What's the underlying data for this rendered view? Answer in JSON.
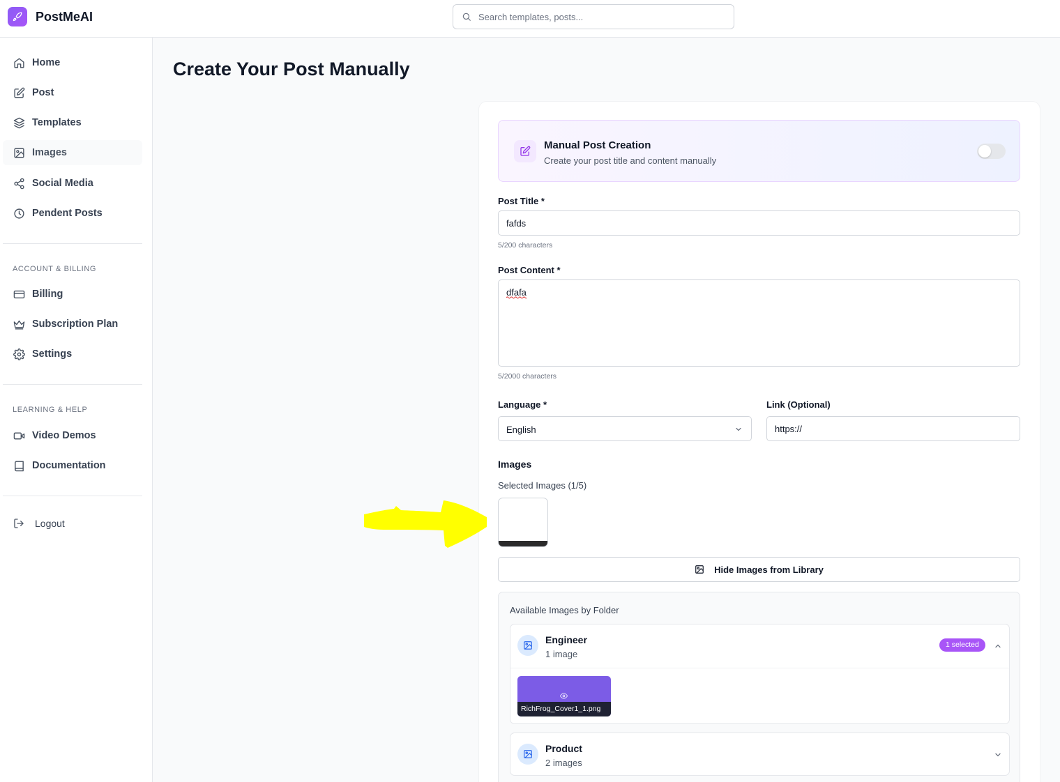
{
  "app": {
    "name": "PostMeAI",
    "brand_color": "#8b5cf6"
  },
  "search": {
    "placeholder": "Search templates, posts..."
  },
  "sidebar": {
    "items": [
      {
        "label": "Home",
        "icon": "home-icon"
      },
      {
        "label": "Post",
        "icon": "edit-icon"
      },
      {
        "label": "Templates",
        "icon": "layers-icon"
      },
      {
        "label": "Images",
        "icon": "image-icon",
        "active": true
      },
      {
        "label": "Social Media",
        "icon": "share-icon"
      },
      {
        "label": "Pendent Posts",
        "icon": "clock-icon"
      }
    ],
    "account_heading": "ACCOUNT & BILLING",
    "account_items": [
      {
        "label": "Billing",
        "icon": "credit-card-icon"
      },
      {
        "label": "Subscription Plan",
        "icon": "crown-icon"
      },
      {
        "label": "Settings",
        "icon": "gear-icon"
      }
    ],
    "help_heading": "LEARNING & HELP",
    "help_items": [
      {
        "label": "Video Demos",
        "icon": "video-icon"
      },
      {
        "label": "Documentation",
        "icon": "book-icon"
      }
    ],
    "logout_label": "Logout"
  },
  "page": {
    "title": "Create Your Post Manually"
  },
  "banner": {
    "title": "Manual Post Creation",
    "subtitle": "Create your post title and content manually",
    "toggle_on": false
  },
  "form": {
    "title_label": "Post Title *",
    "title_value": "fafds",
    "title_count": "5/200 characters",
    "content_label": "Post Content *",
    "content_value": "dfafa",
    "content_count": "5/2000 characters",
    "language_label": "Language *",
    "language_value": "English",
    "link_label": "Link (Optional)",
    "link_value": "https://"
  },
  "images": {
    "heading": "Images",
    "selected_label": "Selected Images (1/5)",
    "hide_button": "Hide Images from Library",
    "folders_heading": "Available Images by Folder",
    "folders": [
      {
        "name": "Engineer",
        "count": "1 image",
        "badge": "1 selected",
        "expanded": true,
        "images": [
          {
            "filename": "RichFrog_Cover1_1.png"
          }
        ]
      },
      {
        "name": "Product",
        "count": "2 images",
        "expanded": false
      }
    ]
  },
  "annotation": {
    "color": "#ffff00",
    "shape": "arrow-right"
  }
}
